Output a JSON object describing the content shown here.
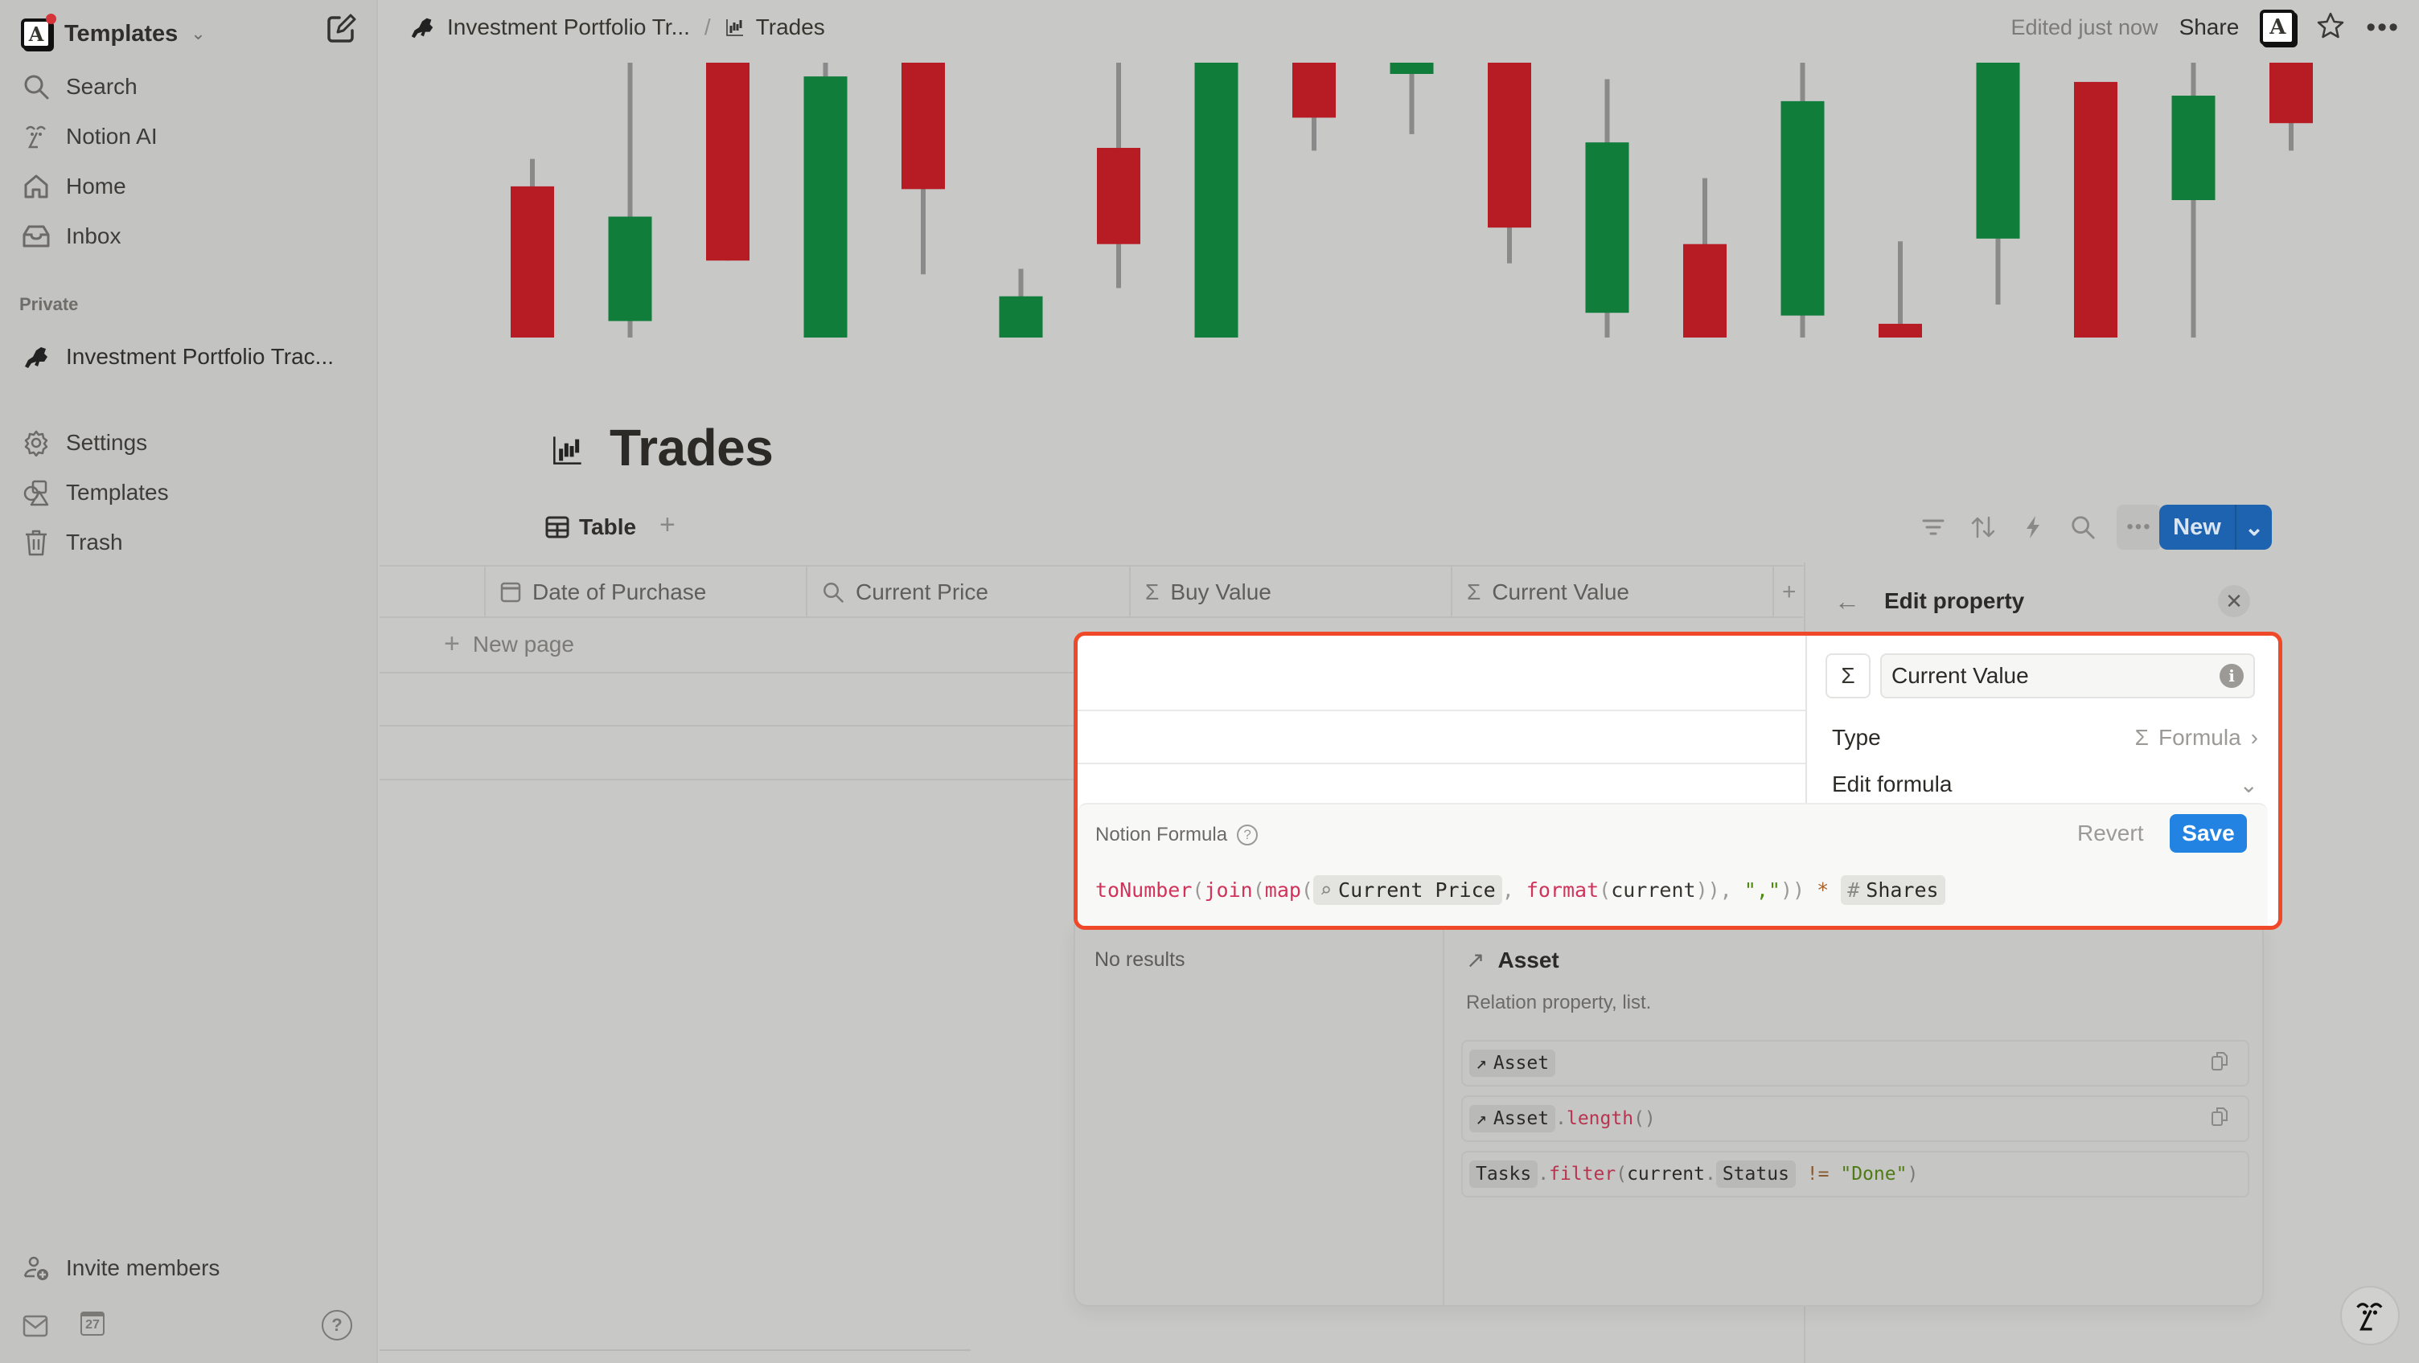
{
  "sidebar": {
    "workspace": {
      "name": "Templates",
      "logo_letter": "A",
      "has_notification": true
    },
    "nav": [
      {
        "label": "Search",
        "icon": "search-icon"
      },
      {
        "label": "Notion AI",
        "icon": "notion-ai-icon"
      },
      {
        "label": "Home",
        "icon": "home-icon"
      },
      {
        "label": "Inbox",
        "icon": "inbox-icon"
      }
    ],
    "section_private": "Private",
    "private_pages": [
      {
        "label": "Investment Portfolio Trac...",
        "icon": "bull-icon"
      }
    ],
    "utility": [
      {
        "label": "Settings",
        "icon": "gear-icon"
      },
      {
        "label": "Templates",
        "icon": "templates-icon"
      },
      {
        "label": "Trash",
        "icon": "trash-icon"
      }
    ],
    "invite": "Invite members",
    "calendar_day": "27"
  },
  "topbar": {
    "breadcrumb": [
      {
        "label": "Investment Portfolio Tr...",
        "icon": "bull-icon"
      },
      {
        "label": "Trades",
        "icon": "candlestick-icon"
      }
    ],
    "separator": "/",
    "edited": "Edited just now",
    "share": "Share",
    "avatar_letter": "A"
  },
  "banner": {
    "colors": {
      "up": "#117d3a",
      "down": "#b71c24",
      "wick": "#8a8a8a"
    },
    "candles": [
      {
        "o": 0.55,
        "c": 0.0,
        "h": 0.65,
        "l": 0.0
      },
      {
        "o": 0.06,
        "c": 0.44,
        "h": 1.0,
        "l": 0.0
      },
      {
        "o": 1.0,
        "c": 0.28,
        "h": 1.0,
        "l": 0.28
      },
      {
        "o": 0.0,
        "c": 0.95,
        "h": 1.0,
        "l": 0.0
      },
      {
        "o": 1.0,
        "c": 0.54,
        "h": 1.0,
        "l": 0.23
      },
      {
        "o": 0.0,
        "c": 0.15,
        "h": 0.25,
        "l": 0.0
      },
      {
        "o": 0.69,
        "c": 0.34,
        "h": 1.0,
        "l": 0.18
      },
      {
        "o": 0.0,
        "c": 1.0,
        "h": 1.0,
        "l": 0.0
      },
      {
        "o": 1.0,
        "c": 0.8,
        "h": 1.0,
        "l": 0.68
      },
      {
        "o": 1.0,
        "c": 1.0,
        "h": 1.0,
        "l": 0.74
      },
      {
        "o": 1.0,
        "c": 0.4,
        "h": 1.0,
        "l": 0.27
      },
      {
        "o": 0.09,
        "c": 0.71,
        "h": 0.94,
        "l": 0.0
      },
      {
        "o": 0.34,
        "c": 0.0,
        "h": 0.58,
        "l": 0.0
      },
      {
        "o": 0.08,
        "c": 0.86,
        "h": 1.0,
        "l": 0.0
      },
      {
        "o": 0.05,
        "c": 0.0,
        "h": 0.35,
        "l": 0.0
      },
      {
        "o": 0.36,
        "c": 1.0,
        "h": 1.0,
        "l": 0.12
      },
      {
        "o": 0.93,
        "c": 0.0,
        "h": 0.93,
        "l": 0.0
      },
      {
        "o": 0.5,
        "c": 0.88,
        "h": 1.0,
        "l": 0.0
      },
      {
        "o": 1.0,
        "c": 0.78,
        "h": 1.0,
        "l": 0.68
      }
    ]
  },
  "page": {
    "title": "Trades",
    "views": [
      {
        "label": "Table",
        "icon": "table-icon"
      }
    ],
    "new_button": "New"
  },
  "table": {
    "columns": [
      {
        "label": "Date of Purchase",
        "icon": "calendar-icon"
      },
      {
        "label": "Current Price",
        "icon": "search-icon"
      },
      {
        "label": "Buy Value",
        "icon": "sigma-icon"
      },
      {
        "label": "Current Value",
        "icon": "sigma-icon"
      }
    ],
    "new_page": "New page"
  },
  "edit_property": {
    "title": "Edit property",
    "name_value": "Current Value",
    "type_label": "Type",
    "type_value": "Formula",
    "edit_formula_label": "Edit formula"
  },
  "formula_editor": {
    "label": "Notion Formula",
    "revert": "Revert",
    "save": "Save",
    "tokens": [
      {
        "t": "toNumber",
        "k": "fn"
      },
      {
        "t": "(",
        "k": "p"
      },
      {
        "t": "join",
        "k": "fn"
      },
      {
        "t": "(",
        "k": "p"
      },
      {
        "t": "map",
        "k": "fn"
      },
      {
        "t": "(",
        "k": "p"
      },
      {
        "t": "Current Price",
        "k": "chip",
        "icon": "search-icon"
      },
      {
        "t": ", ",
        "k": "p"
      },
      {
        "t": "format",
        "k": "fn"
      },
      {
        "t": "(",
        "k": "p"
      },
      {
        "t": "current",
        "k": "txt"
      },
      {
        "t": ")), ",
        "k": "p"
      },
      {
        "t": "\",\"",
        "k": "str"
      },
      {
        "t": ")) ",
        "k": "p"
      },
      {
        "t": "*",
        "k": "op"
      },
      {
        "t": " ",
        "k": "p"
      },
      {
        "t": "Shares",
        "k": "chip",
        "icon": "hash-icon"
      }
    ],
    "no_results": "No results",
    "help": {
      "title": "Asset",
      "description": "Relation property, list.",
      "examples": [
        {
          "parts": [
            {
              "t": "Asset",
              "k": "chip",
              "icon": "relation-icon"
            }
          ],
          "copy": true
        },
        {
          "parts": [
            {
              "t": "Asset",
              "k": "chip",
              "icon": "relation-icon"
            },
            {
              "t": ".",
              "k": "p"
            },
            {
              "t": "length",
              "k": "fn"
            },
            {
              "t": "()",
              "k": "p"
            }
          ],
          "copy": true
        },
        {
          "parts": [
            {
              "t": "Tasks",
              "k": "chip"
            },
            {
              "t": ".",
              "k": "p"
            },
            {
              "t": "filter",
              "k": "fn"
            },
            {
              "t": "(",
              "k": "p"
            },
            {
              "t": "current",
              "k": "txt"
            },
            {
              "t": ".",
              "k": "p"
            },
            {
              "t": "Status",
              "k": "chip"
            },
            {
              "t": " != ",
              "k": "op"
            },
            {
              "t": "\"Done\"",
              "k": "str"
            },
            {
              "t": ")",
              "k": "p"
            }
          ],
          "copy": false
        }
      ]
    }
  },
  "colors": {
    "accent": "#2383e2",
    "new_button": "#1d63b0",
    "highlight": "#f0492a"
  }
}
